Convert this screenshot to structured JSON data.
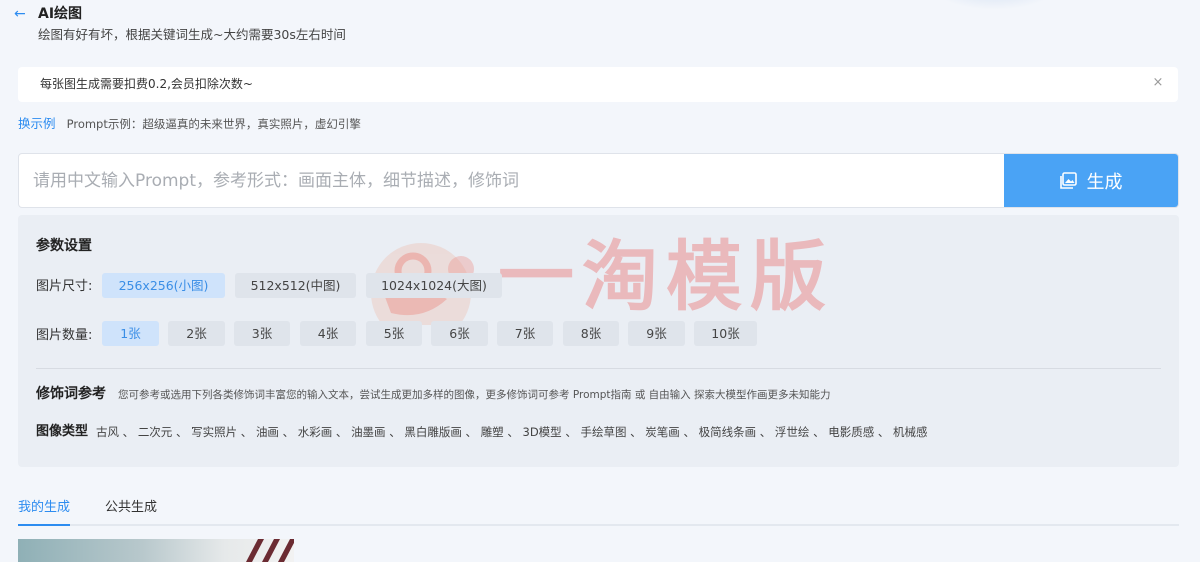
{
  "header": {
    "title": "AI绘图",
    "subtitle": "绘图有好有坏，根据关键词生成~大约需要30s左右时间"
  },
  "notice": {
    "text": "每张图生成需要扣费0.2,会员扣除次数~"
  },
  "example": {
    "link_label": "换示例",
    "text": "Prompt示例：超级逼真的未来世界，真实照片，虚幻引擎"
  },
  "prompt": {
    "placeholder": "请用中文输入Prompt，参考形式：画面主体，细节描述，修饰词",
    "value": "",
    "button_label": "生成"
  },
  "settings": {
    "title": "参数设置",
    "size_label": "图片尺寸:",
    "sizes": [
      "256x256(小图)",
      "512x512(中图)",
      "1024x1024(大图)"
    ],
    "selected_size": "256x256(小图)",
    "count_label": "图片数量:",
    "counts": [
      "1张",
      "2张",
      "3张",
      "4张",
      "5张",
      "6张",
      "7张",
      "8张",
      "9张",
      "10张"
    ],
    "selected_count": "1张",
    "modifier_title": "修饰词参考",
    "modifier_desc": "您可参考或选用下列各类修饰词丰富您的输入文本，尝试生成更加多样的图像，更多修饰词可参考 Prompt指南 或 自由输入 探索大模型作画更多未知能力",
    "image_type_label": "图像类型",
    "image_types": [
      "古风",
      "二次元",
      "写实照片",
      "油画",
      "水彩画",
      "油墨画",
      "黑白雕版画",
      "雕塑",
      "3D模型",
      "手绘草图",
      "炭笔画",
      "极简线条画",
      "浮世绘",
      "电影质感",
      "机械感"
    ],
    "image_type_separator": "、"
  },
  "watermark": {
    "text": "一淘模版"
  },
  "tabs": [
    {
      "label": "我的生成",
      "active": true
    },
    {
      "label": "公共生成",
      "active": false
    }
  ],
  "colors": {
    "accent": "#2d8cf0",
    "button": "#4aa3f5",
    "selected_bg": "#cfe3fb",
    "option_bg": "#dfe4eb",
    "panel_bg": "#eaeef4",
    "page_bg": "#f3f6fb"
  }
}
